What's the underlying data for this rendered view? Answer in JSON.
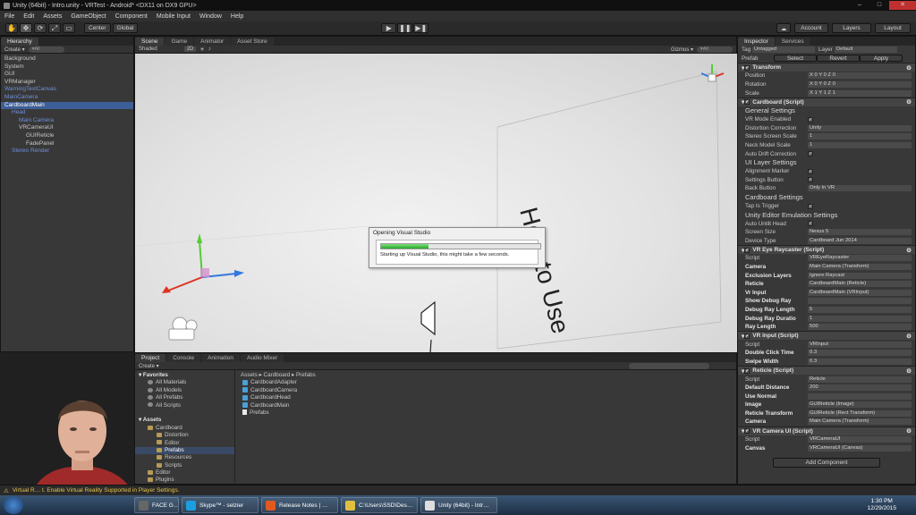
{
  "window": {
    "title": "Unity (64bit) - Intro.unity - VRTest - Android* <DX11 on DX9 GPU>",
    "controls": [
      "–",
      "□",
      "✕"
    ]
  },
  "menu": [
    "File",
    "Edit",
    "Assets",
    "GameObject",
    "Component",
    "Mobile Input",
    "Window",
    "Help"
  ],
  "toolbar": {
    "tools": [
      "✋",
      "✥",
      "⟳",
      "⤢",
      "▭"
    ],
    "pivot": "Center",
    "space": "Global",
    "play": "▶",
    "pause": "❚❚",
    "step": "▶❚",
    "account": "Account",
    "layers": "Layers",
    "layout": "Layout"
  },
  "hierarchy": {
    "tab": "Hierarchy",
    "create": "Create ▾",
    "search": "▾All",
    "items": [
      {
        "label": "Background",
        "indent": 0,
        "style": "normal"
      },
      {
        "label": "System",
        "indent": 0,
        "style": "normal"
      },
      {
        "label": "GUI",
        "indent": 0,
        "style": "normal"
      },
      {
        "label": "VRManager",
        "indent": 0,
        "style": "normal"
      },
      {
        "label": "WarningTextCanvas",
        "indent": 0,
        "style": "blue"
      },
      {
        "label": "MainCamera",
        "indent": 0,
        "style": "blue"
      },
      {
        "label": "CardboardMain",
        "indent": 0,
        "style": "sel"
      },
      {
        "label": "Head",
        "indent": 1,
        "style": "blue"
      },
      {
        "label": "Main Camera",
        "indent": 2,
        "style": "blue"
      },
      {
        "label": "VRCameraUI",
        "indent": 2,
        "style": "normal"
      },
      {
        "label": "GUIReticle",
        "indent": 3,
        "style": "normal"
      },
      {
        "label": "FadePanel",
        "indent": 3,
        "style": "normal"
      },
      {
        "label": "Stereo Render",
        "indent": 1,
        "style": "blue"
      }
    ]
  },
  "scene": {
    "tabs": [
      "Scene",
      "Game",
      "Animator",
      "Asset Store"
    ],
    "shading": "Shaded",
    "mode2d": "2D",
    "gizmos": "Gizmos ▾",
    "search": "▾All",
    "world_text": "How to Use"
  },
  "dialog": {
    "title": "Opening Visual Studio",
    "message": "Starting up Visual Studio, this might take a few seconds.",
    "progress": 0.3
  },
  "project": {
    "tabs": [
      "Project",
      "Console",
      "Animation",
      "Audio Mixer"
    ],
    "create": "Create ▾",
    "tree": [
      {
        "label": "Favorites",
        "kind": "hdr",
        "indent": 0
      },
      {
        "label": "All Materials",
        "kind": "search",
        "indent": 1
      },
      {
        "label": "All Models",
        "kind": "search",
        "indent": 1
      },
      {
        "label": "All Prefabs",
        "kind": "search",
        "indent": 1
      },
      {
        "label": "All Scripts",
        "kind": "search",
        "indent": 1
      },
      {
        "label": "",
        "kind": "gap",
        "indent": 0
      },
      {
        "label": "Assets",
        "kind": "hdr",
        "indent": 0
      },
      {
        "label": "Cardboard",
        "kind": "folder",
        "indent": 1
      },
      {
        "label": "Distortion",
        "kind": "folder",
        "indent": 2
      },
      {
        "label": "Editor",
        "kind": "folder",
        "indent": 2
      },
      {
        "label": "Prefabs",
        "kind": "sel",
        "indent": 2
      },
      {
        "label": "Resources",
        "kind": "folder",
        "indent": 2
      },
      {
        "label": "Scripts",
        "kind": "folder",
        "indent": 2
      },
      {
        "label": "Editor",
        "kind": "folder",
        "indent": 1
      },
      {
        "label": "Plugins",
        "kind": "folder",
        "indent": 1
      }
    ],
    "breadcrumb": "Assets ▸ Cardboard ▸ Prefabs",
    "files": [
      {
        "label": "CardboardAdapter",
        "kind": "prefab"
      },
      {
        "label": "CardboardCamera",
        "kind": "prefab"
      },
      {
        "label": "CardboardHead",
        "kind": "prefab"
      },
      {
        "label": "CardboardMain",
        "kind": "prefab"
      },
      {
        "label": "Prefabs",
        "kind": "blank"
      }
    ]
  },
  "inspector": {
    "tabs": [
      "Inspector",
      "Services"
    ],
    "tag_label": "Tag",
    "tag_value": "Untagged",
    "layer_label": "Layer",
    "layer_value": "Default",
    "prefab": "Prefab",
    "select": "Select",
    "revert": "Revert",
    "apply": "Apply",
    "components": [
      {
        "header": "Transform",
        "rows": [
          {
            "label": "Position",
            "value": "X 0      Y 0      Z 0"
          },
          {
            "label": "Rotation",
            "value": "X 0      Y 0      Z 0"
          },
          {
            "label": "Scale",
            "value": "X 1      Y 1      Z 1"
          }
        ]
      },
      {
        "header": "Cardboard (Script)",
        "rows": [
          {
            "label": "General Settings",
            "type": "section"
          },
          {
            "label": "VR Mode Enabled",
            "value": "✓",
            "type": "check"
          },
          {
            "label": "Distortion Correction",
            "value": "Unity"
          },
          {
            "label": "Stereo Screen Scale",
            "value": "1"
          },
          {
            "label": "Neck Model Scale",
            "value": "1"
          },
          {
            "label": "Auto Drift Correction",
            "value": "✓",
            "type": "check"
          },
          {
            "label": "UI Layer Settings",
            "type": "section"
          },
          {
            "label": "Alignment Marker",
            "value": "✓",
            "type": "check"
          },
          {
            "label": "Settings Button",
            "value": "✓",
            "type": "check"
          },
          {
            "label": "Back Button",
            "value": "Only In VR"
          },
          {
            "label": "Cardboard Settings",
            "type": "section"
          },
          {
            "label": "Tap Is Trigger",
            "value": "✓",
            "type": "check"
          },
          {
            "label": "Unity Editor Emulation Settings",
            "type": "section"
          },
          {
            "label": "Auto Untilt Head",
            "value": "✓",
            "type": "check"
          },
          {
            "label": "Screen Size",
            "value": "Nexus 5"
          },
          {
            "label": "Device Type",
            "value": "Cardboard Jun 2014"
          }
        ]
      },
      {
        "header": "VR Eye Raycaster (Script)",
        "rows": [
          {
            "label": "Script",
            "value": "VREyeRaycaster"
          },
          {
            "label": "Camera",
            "value": "Main Camera (Transform)",
            "bold": true
          },
          {
            "label": "Exclusion Layers",
            "value": "Ignore Raycast",
            "bold": true
          },
          {
            "label": "Reticle",
            "value": "CardboardMain (Reticle)",
            "bold": true
          },
          {
            "label": "Vr Input",
            "value": "CardboardMain (VRInput)",
            "bold": true
          },
          {
            "label": "Show Debug Ray",
            "value": "",
            "bold": true
          },
          {
            "label": "Debug Ray Length",
            "value": "5",
            "bold": true
          },
          {
            "label": "Debug Ray Duratio",
            "value": "1",
            "bold": true
          },
          {
            "label": "Ray Length",
            "value": "500",
            "bold": true
          }
        ]
      },
      {
        "header": "VR Input (Script)",
        "rows": [
          {
            "label": "Script",
            "value": "VRInput"
          },
          {
            "label": "Double Click Time",
            "value": "0.3",
            "bold": true
          },
          {
            "label": "Swipe Width",
            "value": "0.3",
            "bold": true
          }
        ]
      },
      {
        "header": "Reticle (Script)",
        "rows": [
          {
            "label": "Script",
            "value": "Reticle"
          },
          {
            "label": "Default Distance",
            "value": "200",
            "bold": true
          },
          {
            "label": "Use Normal",
            "value": "",
            "bold": true
          },
          {
            "label": "Image",
            "value": "GUIReticle (Image)",
            "bold": true
          },
          {
            "label": "Reticle Transform",
            "value": "GUIReticle (Rect Transform)",
            "bold": true
          },
          {
            "label": "Camera",
            "value": "Main Camera (Transform)",
            "bold": true
          }
        ]
      },
      {
        "header": "VR Camera UI (Script)",
        "rows": [
          {
            "label": "Script",
            "value": "VRCameraUI"
          },
          {
            "label": "Canvas",
            "value": "VRCameraUI (Canvas)",
            "bold": true
          }
        ]
      }
    ],
    "add_component": "Add Component"
  },
  "status": "Virtual R… t. Enable Virtual Reality Supported in Player Settings.",
  "taskbar": {
    "tasks": [
      {
        "label": "FACE G…",
        "color": "#666666"
      },
      {
        "label": "Skype™ - selzier",
        "color": "#1b9fe0"
      },
      {
        "label": "Release Notes | …",
        "color": "#e05a20"
      },
      {
        "label": "C:\\Users\\SSD\\Des…",
        "color": "#e0c040"
      },
      {
        "label": "Unity (64bit) - Intr…",
        "color": "#dddddd"
      }
    ],
    "time": "1:30 PM",
    "date": "12/29/2015"
  },
  "colors": {
    "selection": "#3d5f97",
    "progress": "#2aa82a",
    "warning_text": "#e8c44a"
  }
}
